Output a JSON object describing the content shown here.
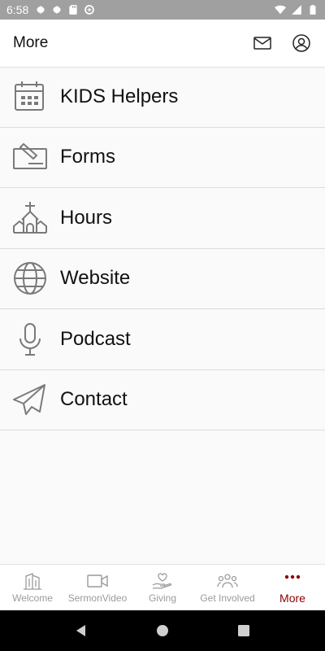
{
  "status_bar": {
    "time": "6:58"
  },
  "header": {
    "title": "More",
    "mail_icon": "mail-icon",
    "account_icon": "account-icon"
  },
  "menu": [
    {
      "label": "KIDS Helpers",
      "icon": "calendar-icon"
    },
    {
      "label": "Forms",
      "icon": "form-edit-icon"
    },
    {
      "label": "Hours",
      "icon": "church-icon"
    },
    {
      "label": "Website",
      "icon": "globe-icon"
    },
    {
      "label": "Podcast",
      "icon": "microphone-icon"
    },
    {
      "label": "Contact",
      "icon": "paper-plane-icon"
    }
  ],
  "tabs": [
    {
      "label": "Welcome",
      "icon": "building-icon",
      "active": false
    },
    {
      "label": "SermonVideo",
      "icon": "video-camera-icon",
      "active": false
    },
    {
      "label": "Giving",
      "icon": "heart-hand-icon",
      "active": false
    },
    {
      "label": "Get Involved",
      "icon": "people-icon",
      "active": false
    },
    {
      "label": "More",
      "icon": "more-dots-icon",
      "active": true
    }
  ],
  "colors": {
    "accent": "#8b0000",
    "icon_gray": "#7a7a7a",
    "status_bar": "#a0a0a0"
  }
}
